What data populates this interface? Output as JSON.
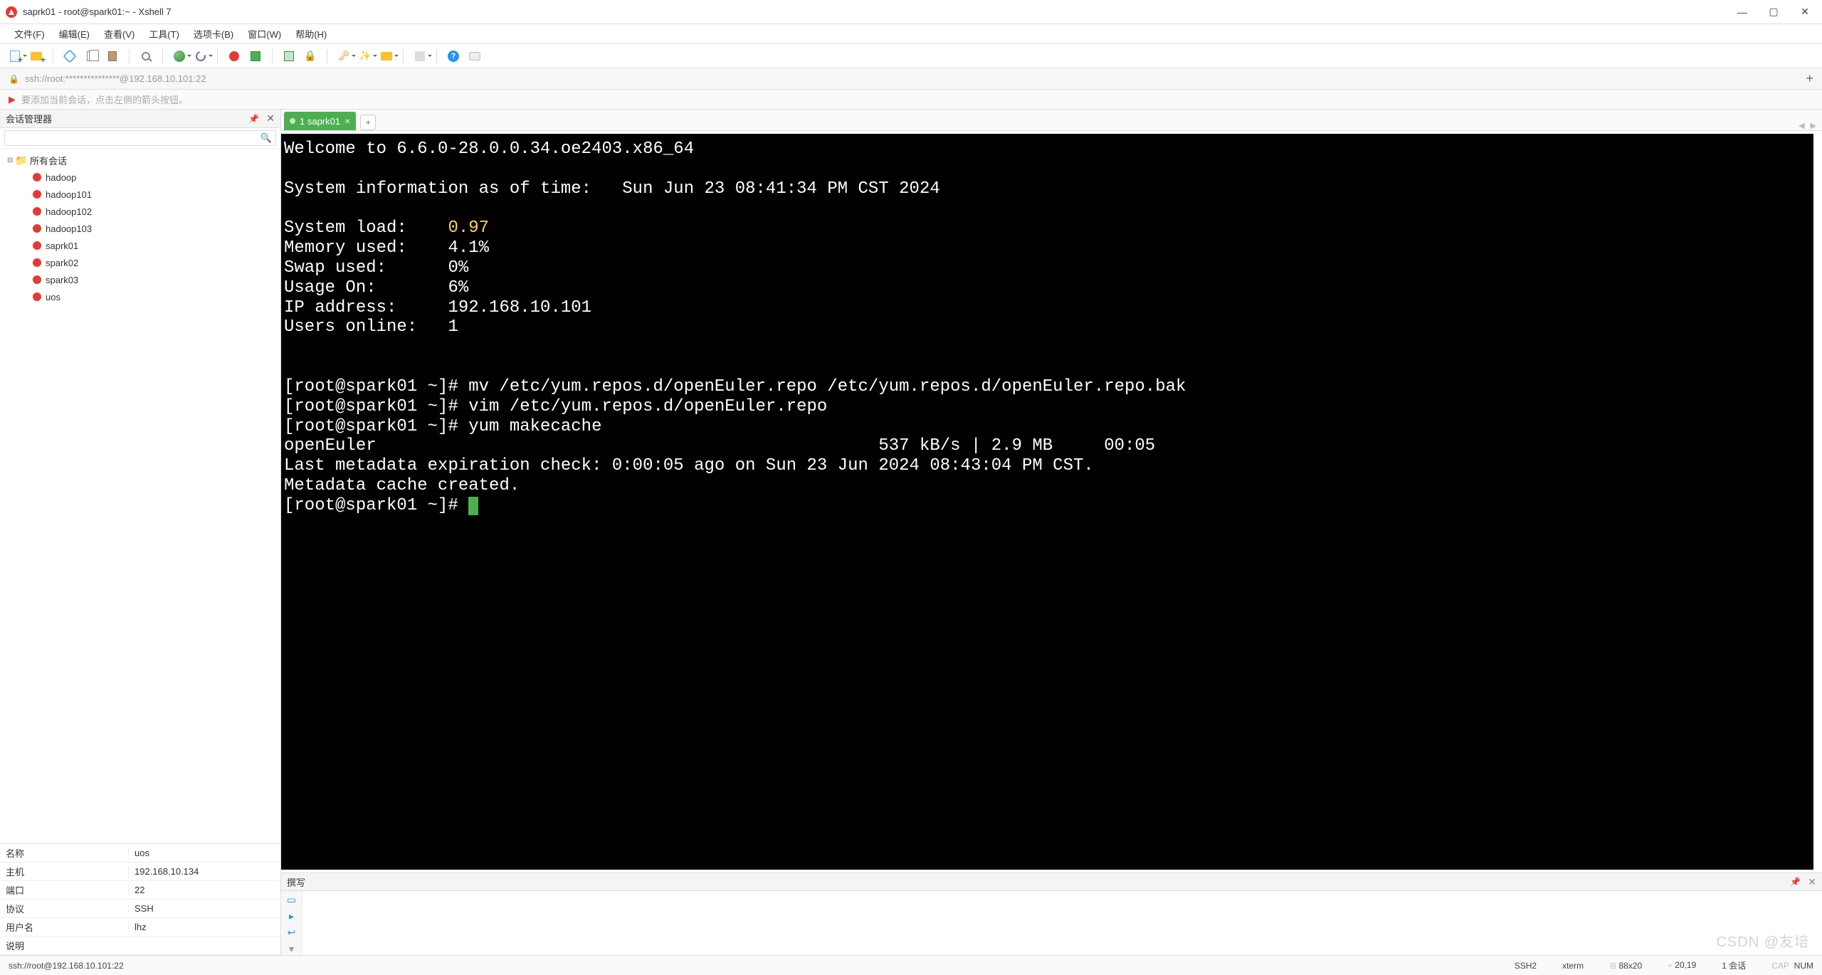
{
  "titlebar": {
    "title": "saprk01 - root@spark01:~ - Xshell 7"
  },
  "menu": {
    "file": "文件(F)",
    "edit": "编辑(E)",
    "view": "查看(V)",
    "tools": "工具(T)",
    "tab": "选项卡(B)",
    "window": "窗口(W)",
    "help": "帮助(H)"
  },
  "addressbar": {
    "text": "ssh://root:***************@192.168.10.101:22"
  },
  "hintbar": {
    "text": "要添加当前会话，点击左侧的箭头按钮。"
  },
  "sidebar": {
    "panel_title": "会话管理器",
    "search_placeholder": "",
    "root_label": "所有会话",
    "sessions": [
      {
        "label": "hadoop"
      },
      {
        "label": "hadoop101"
      },
      {
        "label": "hadoop102"
      },
      {
        "label": "hadoop103"
      },
      {
        "label": "saprk01"
      },
      {
        "label": "spark02"
      },
      {
        "label": "spark03"
      },
      {
        "label": "uos"
      }
    ]
  },
  "properties": {
    "rows": [
      {
        "k": "名称",
        "v": "uos"
      },
      {
        "k": "主机",
        "v": "192.168.10.134"
      },
      {
        "k": "端口",
        "v": "22"
      },
      {
        "k": "协议",
        "v": "SSH"
      },
      {
        "k": "用户名",
        "v": "lhz"
      },
      {
        "k": "说明",
        "v": ""
      }
    ]
  },
  "tabs": {
    "active_label": "1 saprk01"
  },
  "terminal": {
    "welcome": "Welcome to 6.6.0-28.0.0.34.oe2403.x86_64",
    "sysinfo_header": "System information as of time:   Sun Jun 23 08:41:34 PM CST 2024",
    "load_label": "System load:    ",
    "load_value": "0.97",
    "mem": "Memory used:    4.1%",
    "swap": "Swap used:      0%",
    "usage": "Usage On:       6%",
    "ip": "IP address:     192.168.10.101",
    "users": "Users online:   1",
    "cmd1": "[root@spark01 ~]# mv /etc/yum.repos.d/openEuler.repo /etc/yum.repos.d/openEuler.repo.bak",
    "cmd2": "[root@spark01 ~]# vim /etc/yum.repos.d/openEuler.repo",
    "cmd3": "[root@spark01 ~]# yum makecache",
    "repo_line": "openEuler                                                 537 kB/s | 2.9 MB     00:05",
    "meta_line": "Last metadata expiration check: 0:00:05 ago on Sun 23 Jun 2024 08:43:04 PM CST.",
    "cache_line": "Metadata cache created.",
    "prompt": "[root@spark01 ~]# "
  },
  "compose": {
    "title": "撰写"
  },
  "statusbar": {
    "left": "ssh://root@192.168.10.101:22",
    "ssh": "SSH2",
    "term": "xterm",
    "size": "88x20",
    "pos": "20,19",
    "sessions": "1 会话",
    "cap": "CAP",
    "num": "NUM"
  },
  "watermark": "CSDN @友培"
}
